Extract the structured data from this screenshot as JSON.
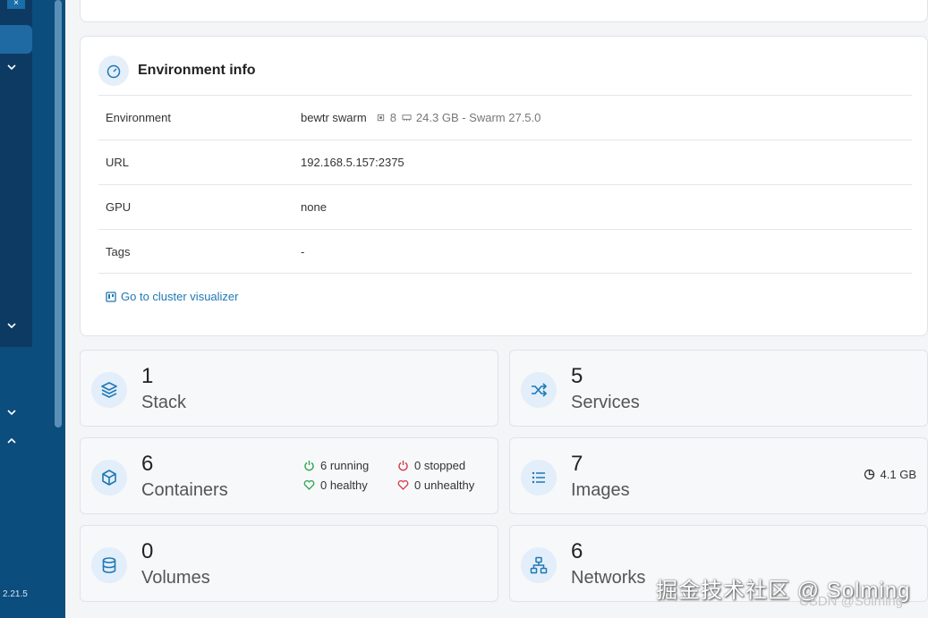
{
  "sidebar": {
    "version": "2.21.5"
  },
  "env_info": {
    "title": "Environment info",
    "rows": [
      {
        "label": "Environment",
        "value": "bewtr swarm",
        "cpu": "8",
        "memory": "24.3 GB - Swarm 27.5.0"
      },
      {
        "label": "URL",
        "value": "192.168.5.157:2375"
      },
      {
        "label": "GPU",
        "value": "none"
      },
      {
        "label": "Tags",
        "value": "-"
      }
    ],
    "link": "Go to cluster visualizer"
  },
  "tiles": {
    "stack": {
      "count": "1",
      "label": "Stack",
      "icon": "layers-icon"
    },
    "services": {
      "count": "5",
      "label": "Services",
      "icon": "shuffle-icon"
    },
    "containers": {
      "count": "6",
      "label": "Containers",
      "icon": "box-icon",
      "running": "6 running",
      "stopped": "0 stopped",
      "healthy": "0 healthy",
      "unhealthy": "0 unhealthy"
    },
    "images": {
      "count": "7",
      "label": "Images",
      "icon": "list-icon",
      "size": "4.1 GB"
    },
    "volumes": {
      "count": "0",
      "label": "Volumes",
      "icon": "database-icon"
    },
    "networks": {
      "count": "6",
      "label": "Networks",
      "icon": "network-icon"
    }
  },
  "colors": {
    "sidebar": "#0b4d7c",
    "accent": "#1f77b4",
    "running": "#2ea44f",
    "stopped": "#d73a49"
  },
  "watermark": {
    "main": "掘金技术社区 @ Solming",
    "sub": "CSDN @Solming"
  }
}
